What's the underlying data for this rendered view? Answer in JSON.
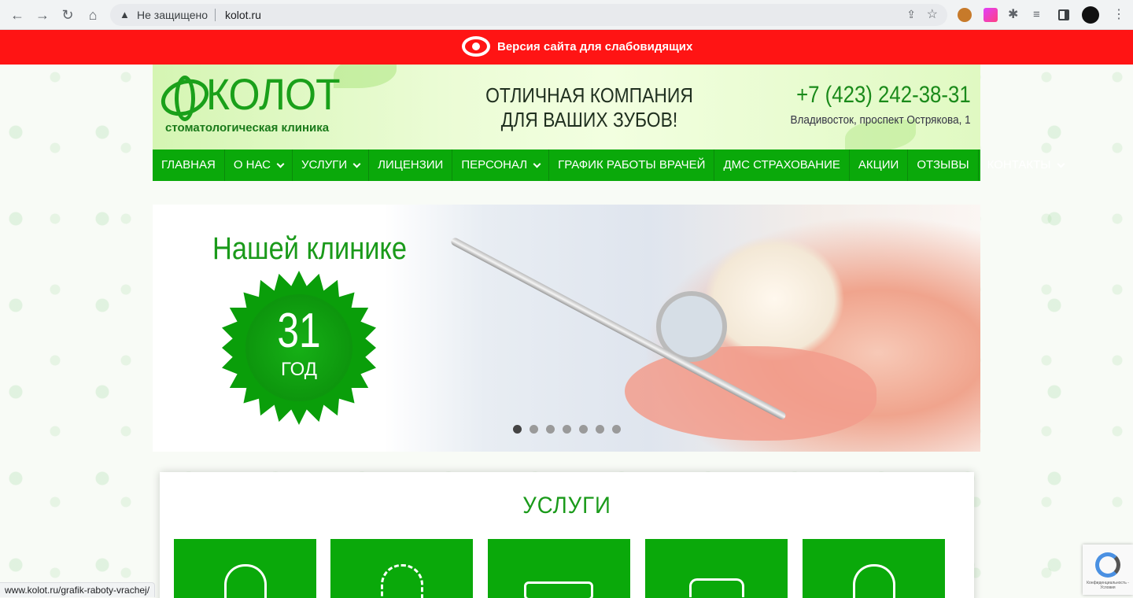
{
  "browser": {
    "back": "←",
    "forward": "→",
    "reload": "↻",
    "home": "⌂",
    "security_label": "Не защищено",
    "url": "kolot.ru",
    "share": "⇪",
    "star": "☆",
    "puzzle": "✱",
    "media": "≡",
    "menu": "⋮"
  },
  "a11y_bar": {
    "label": "Версия сайта для слабовидящих",
    "color": "#ff1414"
  },
  "header": {
    "logo_name": "КОЛОТ",
    "logo_sub": "стоматологическая клиника",
    "slogan_line1": "ОТЛИЧНАЯ КОМПАНИЯ",
    "slogan_line2": "ДЛЯ ВАШИХ ЗУБОВ!",
    "phone": "+7 (423) 242-38-31",
    "address": "Владивосток, проспект Острякова, 1"
  },
  "menu": {
    "items": [
      {
        "label": "ГЛАВНАЯ",
        "has_dropdown": false
      },
      {
        "label": "О НАС",
        "has_dropdown": true
      },
      {
        "label": "УСЛУГИ",
        "has_dropdown": true
      },
      {
        "label": "ЛИЦЕНЗИИ",
        "has_dropdown": false
      },
      {
        "label": "ПЕРСОНАЛ",
        "has_dropdown": true
      },
      {
        "label": "ГРАФИК РАБОТЫ ВРАЧЕЙ",
        "has_dropdown": false
      },
      {
        "label": "ДМС СТРАХОВАНИЕ",
        "has_dropdown": false
      },
      {
        "label": "АКЦИИ",
        "has_dropdown": false
      },
      {
        "label": "ОТЗЫВЫ",
        "has_dropdown": false
      },
      {
        "label": "КОНТАКТЫ",
        "has_dropdown": true
      }
    ],
    "color": "#0aa90a"
  },
  "slider": {
    "title": "Нашей клинике",
    "badge_number": "31",
    "badge_unit": "ГОД",
    "slide_count": 7,
    "active_slide": 1
  },
  "services": {
    "title": "УСЛУГИ",
    "cards": [
      {
        "icon": "broken-tooth-icon"
      },
      {
        "icon": "tooth-outline-icon"
      },
      {
        "icon": "braces-icon"
      },
      {
        "icon": "dentures-icon"
      },
      {
        "icon": "tooth-icon"
      }
    ]
  },
  "status_bar": {
    "url": "www.kolot.ru/grafik-raboty-vrachej/"
  },
  "recaptcha": {
    "text": "Конфиденциальность - Условия"
  }
}
